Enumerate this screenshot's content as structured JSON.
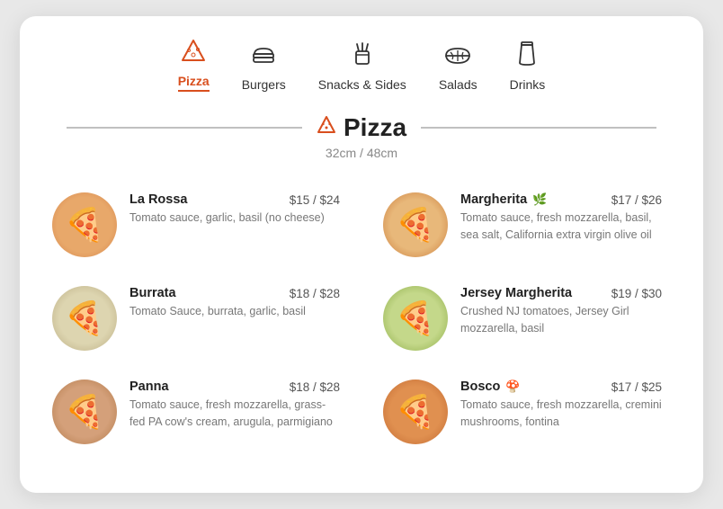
{
  "nav": {
    "items": [
      {
        "id": "pizza",
        "label": "Pizza",
        "active": true,
        "icon": "pizza"
      },
      {
        "id": "burgers",
        "label": "Burgers",
        "active": false,
        "icon": "burger"
      },
      {
        "id": "snacks",
        "label": "Snacks & Sides",
        "active": false,
        "icon": "fries"
      },
      {
        "id": "salads",
        "label": "Salads",
        "active": false,
        "icon": "salad"
      },
      {
        "id": "drinks",
        "label": "Drinks",
        "active": false,
        "icon": "drink"
      }
    ]
  },
  "section": {
    "title": "Pizza",
    "subtitle": "32cm / 48cm"
  },
  "menu_items": [
    {
      "id": "la-rossa",
      "name": "La Rossa",
      "price": "$15 / $24",
      "desc": "Tomato sauce, garlic, basil (no cheese)",
      "color": "la-rossa",
      "badge": ""
    },
    {
      "id": "margherita",
      "name": "Margherita",
      "price": "$17 / $26",
      "desc": "Tomato sauce, fresh mozzarella, basil, sea salt, California extra virgin olive oil",
      "color": "margherita",
      "badge": "🌿"
    },
    {
      "id": "burrata",
      "name": "Burrata",
      "price": "$18 / $28",
      "desc": "Tomato Sauce, burrata, garlic, basil",
      "color": "burrata",
      "badge": ""
    },
    {
      "id": "jersey-margherita",
      "name": "Jersey Margherita",
      "price": "$19 / $30",
      "desc": "Crushed NJ tomatoes, Jersey Girl mozzarella, basil",
      "color": "jersey",
      "badge": ""
    },
    {
      "id": "panna",
      "name": "Panna",
      "price": "$18 / $28",
      "desc": "Tomato sauce, fresh mozzarella, grass-fed PA cow's cream, arugula, parmigiano",
      "color": "panna",
      "badge": ""
    },
    {
      "id": "bosco",
      "name": "Bosco",
      "price": "$17 / $25",
      "desc": "Tomato sauce, fresh mozzarella, cremini mushrooms, fontina",
      "color": "bosco",
      "badge": "🍄"
    }
  ],
  "colors": {
    "accent": "#d94f1e"
  }
}
